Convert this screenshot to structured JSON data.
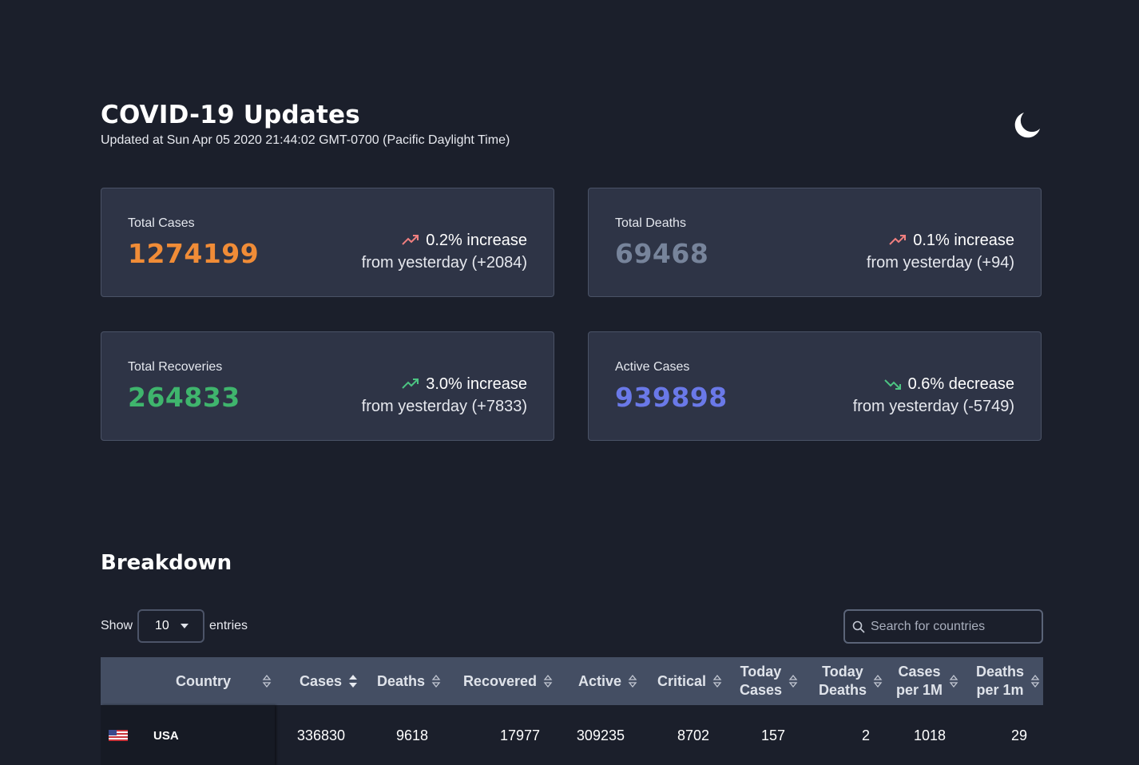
{
  "header": {
    "title": "COVID-19 Updates",
    "updated": "Updated at Sun Apr 05 2020 21:44:02 GMT-0700 (Pacific Daylight Time)",
    "theme_icon": "moon-icon"
  },
  "cards": [
    {
      "label": "Total Cases",
      "value": "1274199",
      "value_color": "#f08c37",
      "trend": "up",
      "trend_color": "#f07f7f",
      "change": "0.2% increase",
      "change_sub": "from yesterday (+2084)"
    },
    {
      "label": "Total Deaths",
      "value": "69468",
      "value_color": "#77849b",
      "trend": "up",
      "trend_color": "#f07f7f",
      "change": "0.1% increase",
      "change_sub": "from yesterday (+94)"
    },
    {
      "label": "Total Recoveries",
      "value": "264833",
      "value_color": "#3fb56d",
      "trend": "up",
      "trend_color": "#4cc482",
      "change": "3.0% increase",
      "change_sub": "from yesterday (+7833)"
    },
    {
      "label": "Active Cases",
      "value": "939898",
      "value_color": "#6a79e8",
      "trend": "down",
      "trend_color": "#4cc482",
      "change": "0.6% decrease",
      "change_sub": "from yesterday (-5749)"
    }
  ],
  "breakdown": {
    "title": "Breakdown",
    "show_label": "Show",
    "entries_label": "entries",
    "page_size": "10",
    "search_placeholder": "Search for countries"
  },
  "table": {
    "columns": [
      [
        "Country"
      ],
      [
        "Cases"
      ],
      [
        "Deaths"
      ],
      [
        "Recovered"
      ],
      [
        "Active"
      ],
      [
        "Critical"
      ],
      [
        "Today",
        "Cases"
      ],
      [
        "Today",
        "Deaths"
      ],
      [
        "Cases",
        "per 1M"
      ],
      [
        "Deaths",
        "per 1m"
      ]
    ],
    "rows": [
      {
        "country": "USA",
        "flag": "us-flag-icon",
        "values": [
          "336830",
          "9618",
          "17977",
          "309235",
          "8702",
          "157",
          "2",
          "1018",
          "29"
        ]
      }
    ]
  }
}
